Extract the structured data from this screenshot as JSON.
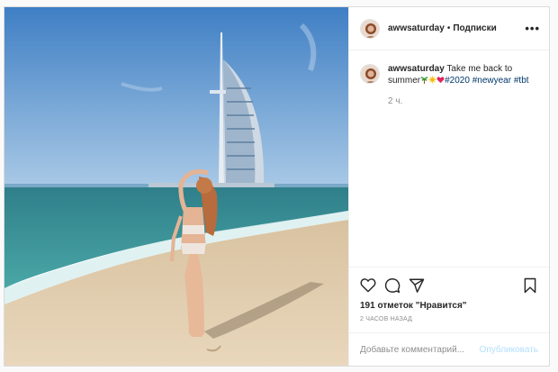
{
  "post": {
    "username": "awwsaturday",
    "separator": "•",
    "follow_label": "Подписки",
    "more_label": "•••",
    "caption": {
      "username": "awwsaturday",
      "text_before": "Take me back to summer",
      "tags": [
        "#2020",
        "#newyear",
        "#tbt"
      ],
      "emoji_names": [
        "palm-tree-emoji",
        "sun-emoji",
        "heart-emoji"
      ]
    },
    "caption_time": "2 ч.",
    "likes_text": "191 отметок \"Нравится\"",
    "time_ago": "2 ЧАСОВ НАЗАД",
    "comment_placeholder": "Добавьте комментарий...",
    "publish_label": "Опубликовать",
    "icons": [
      "heart-icon",
      "comment-icon",
      "share-icon",
      "bookmark-icon"
    ],
    "colors": {
      "link": "#00376b",
      "muted": "#8e8e8e",
      "publish": "#b2dffc",
      "border": "#dbdbdb"
    }
  }
}
